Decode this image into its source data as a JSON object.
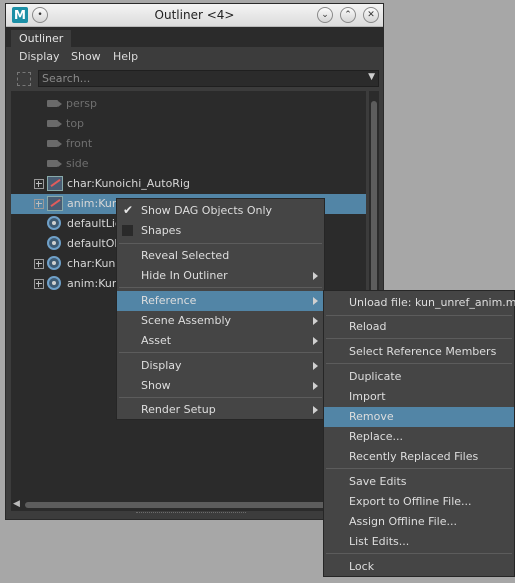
{
  "window": {
    "title": "Outliner <4>",
    "logo": "M",
    "tab": "Outliner",
    "minimize_icon": "chevron-down-icon",
    "maximize_icon": "chevron-up-icon",
    "close_icon": "close-icon"
  },
  "menubar": [
    "Display",
    "Show",
    "Help"
  ],
  "search": {
    "placeholder": "Search..."
  },
  "tree": [
    {
      "label": "persp",
      "icon": "camera-icon",
      "dim": true,
      "expander": false
    },
    {
      "label": "top",
      "icon": "camera-icon",
      "dim": true,
      "expander": false
    },
    {
      "label": "front",
      "icon": "camera-icon",
      "dim": true,
      "expander": false
    },
    {
      "label": "side",
      "icon": "camera-icon",
      "dim": true,
      "expander": false
    },
    {
      "label": "char:Kunoichi_AutoRig",
      "icon": "reference-icon",
      "dim": false,
      "expander": true
    },
    {
      "label": "anim:Kunoichi_AutoRig",
      "icon": "reference-icon",
      "dim": false,
      "expander": true,
      "selected": true
    },
    {
      "label": "defaultLightSet",
      "icon": "set-icon",
      "dim": false,
      "expander": false
    },
    {
      "label": "defaultObjectSet",
      "icon": "set-icon",
      "dim": false,
      "expander": false
    },
    {
      "label": "char:Kunoichi",
      "icon": "set-icon",
      "dim": false,
      "expander": true
    },
    {
      "label": "anim:Kunoichi",
      "icon": "set-icon",
      "dim": false,
      "expander": true
    }
  ],
  "context_menu": {
    "items": [
      {
        "label": "Show DAG Objects Only",
        "check": "checked"
      },
      {
        "label": "Shapes",
        "check": "box"
      },
      {
        "label": "Reveal Selected"
      },
      {
        "label": "Hide In Outliner",
        "submenu": true
      },
      {
        "label": "Reference",
        "submenu": true,
        "highlighted": true
      },
      {
        "label": "Scene Assembly",
        "submenu": true
      },
      {
        "label": "Asset",
        "submenu": true
      },
      {
        "label": "Display",
        "submenu": true
      },
      {
        "label": "Show",
        "submenu": true
      },
      {
        "label": "Render Setup",
        "submenu": true
      }
    ]
  },
  "reference_menu": {
    "items": [
      {
        "label": "Unload file: kun_unref_anim.ma"
      },
      {
        "label": "Reload"
      },
      {
        "label": "Select Reference Members"
      },
      {
        "label": "Duplicate"
      },
      {
        "label": "Import"
      },
      {
        "label": "Remove",
        "highlighted": true
      },
      {
        "label": "Replace..."
      },
      {
        "label": "Recently Replaced Files"
      },
      {
        "label": "Save Edits"
      },
      {
        "label": "Export to Offline File..."
      },
      {
        "label": "Assign Offline File..."
      },
      {
        "label": "List Edits..."
      },
      {
        "label": "Lock"
      }
    ]
  },
  "colors": {
    "highlight": "#5285a6",
    "panel": "#3c3c3c",
    "field": "#2b2b2b"
  }
}
